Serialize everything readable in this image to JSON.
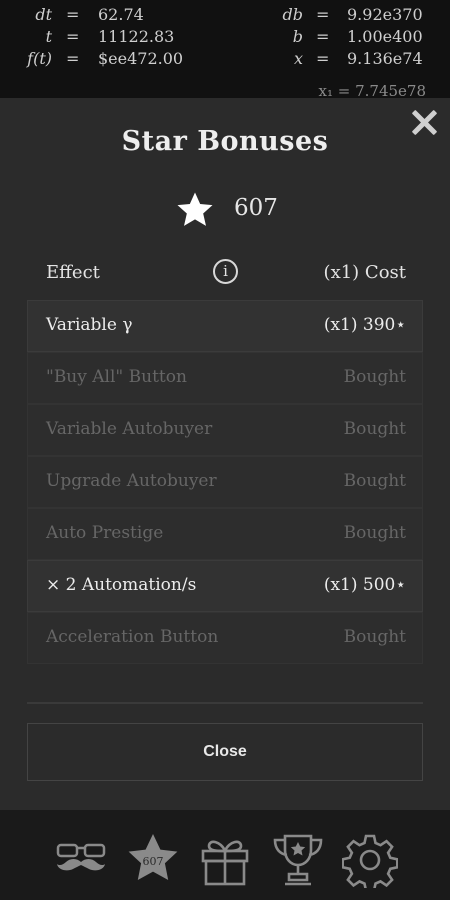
{
  "equations": {
    "left": [
      {
        "symbol": "dt",
        "value": "62.74"
      },
      {
        "symbol": "t",
        "value": "11122.83"
      },
      {
        "symbol": "f(t)",
        "value": "$ee472.00"
      }
    ],
    "right": [
      {
        "symbol": "db",
        "value": "9.92e370"
      },
      {
        "symbol": "b",
        "value": "1.00e400"
      },
      {
        "symbol": "x",
        "value": "9.136e74"
      }
    ],
    "x1_partial": "x₁ = 7.745e78",
    "equals_sign": "="
  },
  "modal": {
    "title": "Star Bonuses",
    "star_count": "607",
    "header": {
      "effect": "Effect",
      "info": "i",
      "cost": "(x1) Cost"
    },
    "rows": [
      {
        "label": "Variable γ",
        "cost": "(x1) 390⋆",
        "state": "active"
      },
      {
        "label": "\"Buy All\" Button",
        "cost": "Bought",
        "state": "bought"
      },
      {
        "label": "Variable Autobuyer",
        "cost": "Bought",
        "state": "bought"
      },
      {
        "label": "Upgrade Autobuyer",
        "cost": "Bought",
        "state": "bought"
      },
      {
        "label": "Auto Prestige",
        "cost": "Bought",
        "state": "bought"
      },
      {
        "label": "× 2 Automation/s",
        "cost": "(x1) 500⋆",
        "state": "active"
      },
      {
        "label": "Acceleration Button",
        "cost": "Bought",
        "state": "bought"
      }
    ],
    "close_button": "Close"
  },
  "nav": {
    "star_badge": "607",
    "items": [
      {
        "icon": "mustache-glasses-icon"
      },
      {
        "icon": "star-icon"
      },
      {
        "icon": "gift-icon"
      },
      {
        "icon": "trophy-icon"
      },
      {
        "icon": "gear-icon"
      }
    ]
  }
}
